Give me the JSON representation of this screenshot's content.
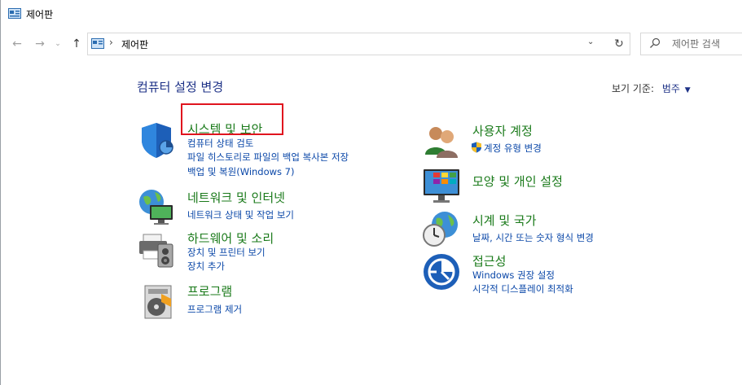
{
  "window": {
    "title": "제어판"
  },
  "toolbar": {
    "back_icon": "back-arrow-icon",
    "forward_icon": "forward-arrow-icon",
    "up_icon": "up-arrow-icon",
    "breadcrumb": "제어판",
    "refresh_icon": "refresh-icon",
    "search_placeholder": "제어판 검색"
  },
  "main": {
    "heading": "컴퓨터 설정 변경",
    "view_by_label": "보기 기준:",
    "view_by_value": "범주",
    "left_categories": [
      {
        "title": "시스템 및 보안",
        "links": [
          "컴퓨터 상태 검토",
          "파일 히스토리로 파일의 백업 복사본 저장",
          "백업 및 복원(Windows 7)"
        ],
        "icon": "shield-icon"
      },
      {
        "title": "네트워크 및 인터넷",
        "links": [
          "네트워크 상태 및 작업 보기"
        ],
        "icon": "network-globe-icon"
      },
      {
        "title": "하드웨어 및 소리",
        "links": [
          "장치 및 프린터 보기",
          "장치 추가"
        ],
        "icon": "printer-speaker-icon"
      },
      {
        "title": "프로그램",
        "links": [
          "프로그램 제거"
        ],
        "icon": "program-disc-icon"
      }
    ],
    "right_categories": [
      {
        "title": "사용자 계정",
        "links": [
          "계정 유형 변경"
        ],
        "icon": "users-icon"
      },
      {
        "title": "모양 및 개인 설정",
        "links": [],
        "icon": "monitor-palette-icon"
      },
      {
        "title": "시계 및 국가",
        "links": [
          "날짜, 시간 또는 숫자 형식 변경"
        ],
        "icon": "clock-globe-icon"
      },
      {
        "title": "접근성",
        "links": [
          "Windows 권장 설정",
          "시각적 디스플레이 최적화"
        ],
        "icon": "accessibility-icon"
      }
    ]
  },
  "colors": {
    "category_title": "#1a7a1a",
    "link": "#0a47a8",
    "heading": "#1e3287",
    "highlight_box": "#e0141e"
  }
}
